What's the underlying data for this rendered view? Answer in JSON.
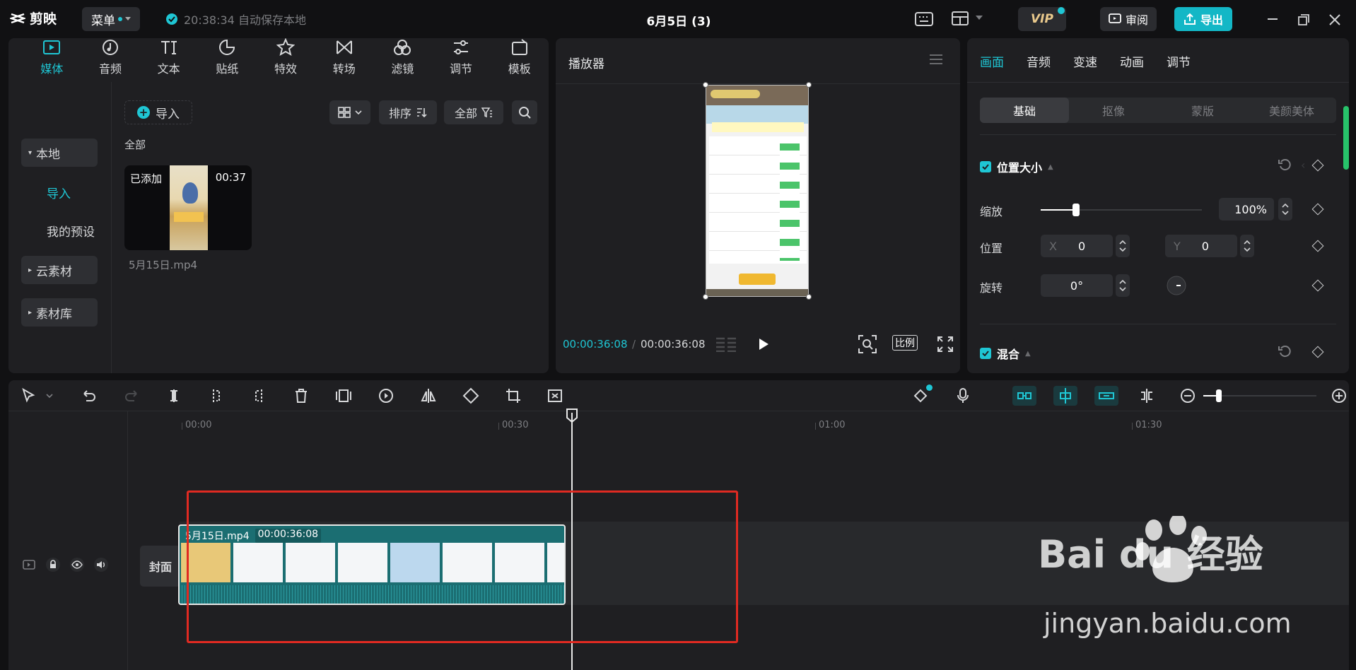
{
  "app": {
    "name": "剪映",
    "menu_label": "菜单",
    "save_status": "20:38:34 自动保存本地",
    "project_title": "6月5日 (3)"
  },
  "topbar": {
    "vip_label": "VIP",
    "review_label": "审阅",
    "export_label": "导出"
  },
  "media": {
    "tabs": [
      {
        "label": "媒体",
        "icon": "media-icon"
      },
      {
        "label": "音频",
        "icon": "audio-icon"
      },
      {
        "label": "文本",
        "icon": "text-icon"
      },
      {
        "label": "贴纸",
        "icon": "sticker-icon"
      },
      {
        "label": "特效",
        "icon": "effects-icon"
      },
      {
        "label": "转场",
        "icon": "transition-icon"
      },
      {
        "label": "滤镜",
        "icon": "filter-icon"
      },
      {
        "label": "调节",
        "icon": "adjust-icon"
      },
      {
        "label": "模板",
        "icon": "template-icon"
      }
    ],
    "sidebar": {
      "local": "本地",
      "import": "导入",
      "my_presets": "我的预设",
      "cloud": "云素材",
      "library": "素材库"
    },
    "import_label": "导入",
    "sort_label": "排序",
    "filter_label": "全部",
    "section_label": "全部",
    "clip": {
      "badge": "已添加",
      "duration": "00:37",
      "name": "5月15日.mp4"
    }
  },
  "player": {
    "title": "播放器",
    "current_time": "00:00:36:08",
    "total_time": "00:00:36:08",
    "ratio_label": "比例"
  },
  "props": {
    "tabs": [
      "画面",
      "音频",
      "变速",
      "动画",
      "调节"
    ],
    "subtabs": [
      "基础",
      "抠像",
      "蒙版",
      "美颜美体"
    ],
    "position_size": "位置大小",
    "scale_label": "缩放",
    "scale_value": "100%",
    "scale_fraction": 0.22,
    "position_label": "位置",
    "x_label": "X",
    "x_value": "0",
    "y_label": "Y",
    "y_value": "0",
    "rotate_label": "旋转",
    "rotate_value": "0°",
    "blend_label": "混合"
  },
  "timeline": {
    "ruler": [
      "00:00",
      "00:30",
      "01:00",
      "01:30"
    ],
    "clip_name": "5月15日.mp4",
    "clip_duration": "00:00:36:08",
    "cover_label": "封面"
  },
  "watermark": {
    "brand": "Bai du 经验",
    "url": "jingyan.baidu.com"
  },
  "colors": {
    "accent": "#1fc6d4",
    "highlight_box": "#e02a22",
    "clip": "#1b6e72"
  }
}
